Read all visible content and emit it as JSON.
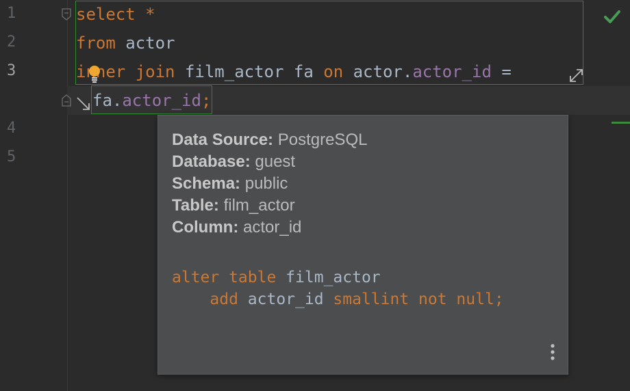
{
  "editor": {
    "line_numbers": [
      "1",
      "2",
      "3",
      "4",
      "5"
    ],
    "lines": [
      [
        {
          "t": "select",
          "c": "kw"
        },
        {
          "t": " ",
          "c": "plain"
        },
        {
          "t": "*",
          "c": "kw"
        }
      ],
      [
        {
          "t": "from",
          "c": "kw"
        },
        {
          "t": " actor",
          "c": "plain"
        }
      ],
      [
        {
          "t": "inner join",
          "c": "kw"
        },
        {
          "t": " film_actor fa ",
          "c": "plain"
        },
        {
          "t": "on",
          "c": "kw"
        },
        {
          "t": " actor.",
          "c": "plain"
        },
        {
          "t": "actor_id",
          "c": "col"
        },
        {
          "t": " =",
          "c": "plain"
        }
      ],
      [
        {
          "t": "fa.",
          "c": "plain"
        },
        {
          "t": "actor_id",
          "c": "col"
        },
        {
          "t": ";",
          "c": "kw"
        }
      ]
    ],
    "colors": {
      "keyword": "#cc7832",
      "column": "#9876aa",
      "text": "#a9b7c6",
      "selection_border": "#2f8a2f",
      "check": "#499c54",
      "bulb": "#f0a732"
    },
    "status": "check-icon"
  },
  "popup": {
    "info": [
      {
        "label": "Data Source:",
        "value": "PostgreSQL"
      },
      {
        "label": "Database:",
        "value": "guest"
      },
      {
        "label": "Schema:",
        "value": "public"
      },
      {
        "label": "Table:",
        "value": "film_actor"
      },
      {
        "label": "Column:",
        "value": "actor_id"
      }
    ],
    "ddl": [
      [
        {
          "t": "alter table",
          "c": "kw"
        },
        {
          "t": " film_actor",
          "c": "plain"
        }
      ],
      [
        {
          "t": "    ",
          "c": "plain"
        },
        {
          "t": "add",
          "c": "kw"
        },
        {
          "t": " actor_id ",
          "c": "plain"
        },
        {
          "t": "smallint not null;",
          "c": "kw"
        }
      ]
    ],
    "more_icon": "more-vertical-icon"
  }
}
